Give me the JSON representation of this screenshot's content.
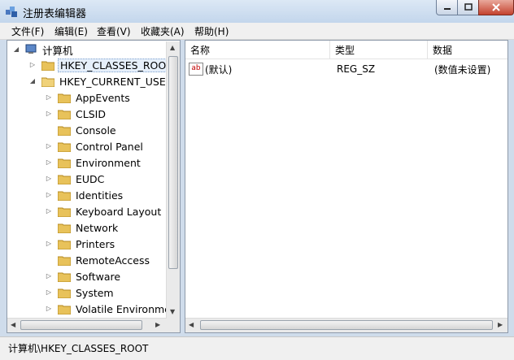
{
  "window": {
    "title": "注册表编辑器"
  },
  "menu": [
    "文件(F)",
    "编辑(E)",
    "查看(V)",
    "收藏夹(A)",
    "帮助(H)"
  ],
  "tree": {
    "root": "计算机",
    "hkcr": "HKEY_CLASSES_ROOT",
    "hkcu": "HKEY_CURRENT_USER",
    "children": [
      "AppEvents",
      "CLSID",
      "Console",
      "Control Panel",
      "Environment",
      "EUDC",
      "Identities",
      "Keyboard Layout",
      "Network",
      "Printers",
      "RemoteAccess",
      "Software",
      "System",
      "Volatile Environmer"
    ]
  },
  "columns": {
    "name": "名称",
    "type": "类型",
    "data": "数据"
  },
  "values": [
    {
      "icon": "ab",
      "name": "(默认)",
      "type": "REG_SZ",
      "data": "(数值未设置)"
    }
  ],
  "status": "计算机\\HKEY_CLASSES_ROOT",
  "colors": {
    "selection": "#e6effa",
    "folder": "#e8c25a",
    "close": "#c4422e"
  }
}
